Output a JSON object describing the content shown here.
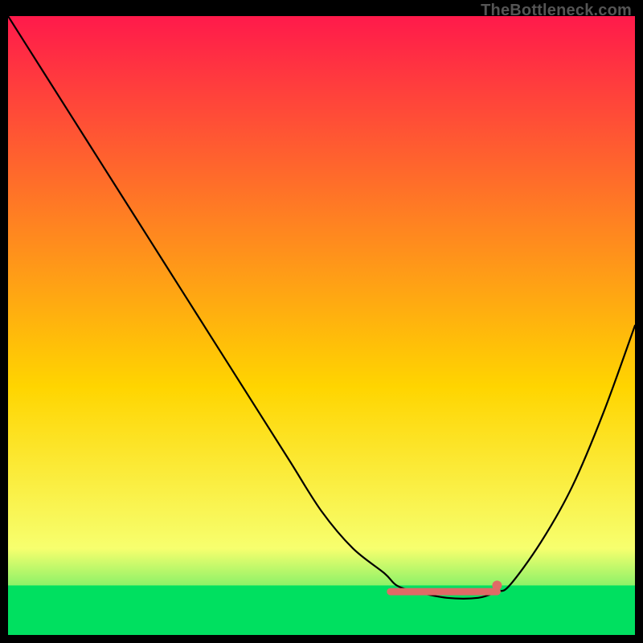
{
  "attribution": "TheBottleneck.com",
  "chart_data": {
    "type": "line",
    "title": "",
    "xlabel": "",
    "ylabel": "",
    "xlim": [
      0,
      100
    ],
    "ylim": [
      0,
      100
    ],
    "gradient_top_color": "#ff1a4b",
    "gradient_mid_color": "#ffd500",
    "gradient_bottom_color": "#00e060",
    "green_band_y": 92,
    "series": [
      {
        "name": "bottleneck-curve",
        "color": "#000000",
        "x": [
          0,
          5,
          10,
          15,
          20,
          25,
          30,
          35,
          40,
          45,
          50,
          55,
          60,
          62,
          65,
          70,
          75,
          78,
          80,
          85,
          90,
          95,
          100
        ],
        "y": [
          0,
          8,
          16,
          24,
          32,
          40,
          48,
          56,
          64,
          72,
          80,
          86,
          90,
          92,
          93,
          94,
          94,
          93,
          92,
          85,
          76,
          64,
          50
        ]
      }
    ],
    "flat_segment": {
      "name": "optimal-band",
      "color": "#e06a66",
      "x_start": 61,
      "x_end": 78,
      "y": 93,
      "end_dot_x": 78,
      "end_dot_y": 92
    }
  }
}
